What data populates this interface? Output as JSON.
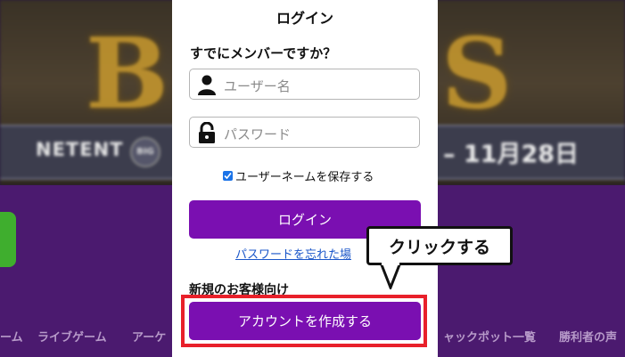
{
  "background": {
    "provider": "NETENT",
    "badge": "BIG",
    "date_range": "– 11月28日",
    "menu_items": [
      "ーム",
      "ライブゲーム",
      "アーケ",
      "ャックポット一覧",
      "勝利者の声"
    ]
  },
  "login_panel": {
    "title": "ログイン",
    "question": "すでにメンバーですか？",
    "username": {
      "placeholder": "ユーザー名",
      "icon": "user-icon"
    },
    "password": {
      "placeholder": "パスワード",
      "icon": "lock-icon"
    },
    "remember_label": "ユーザーネームを保存する",
    "remember_checked": true,
    "login_button": "ログイン",
    "forgot_link": "パスワードを忘れた場",
    "new_customer_heading": "新規のお客様向け",
    "create_account_button": "アカウントを作成する"
  },
  "annotation": {
    "callout_text": "クリックする",
    "highlight_color": "#e8202a"
  },
  "colors": {
    "primary_button": "#7a0fb1",
    "link": "#1a56c9",
    "checkbox": "#1a73e8"
  }
}
